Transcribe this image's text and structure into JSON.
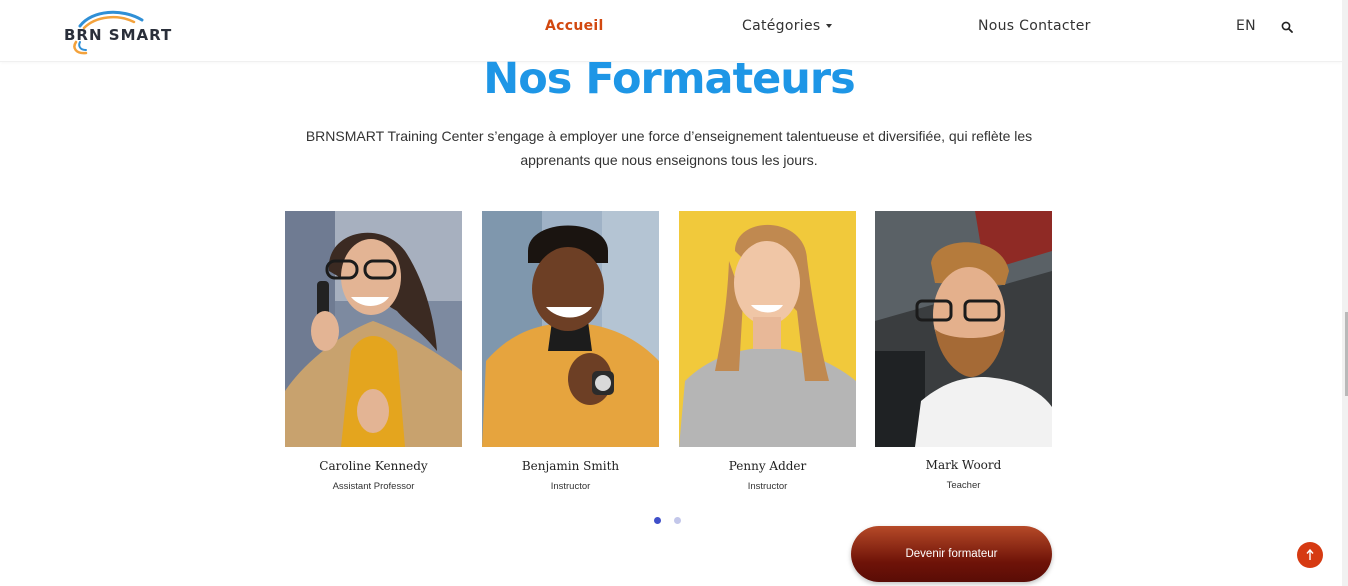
{
  "nav": {
    "logo_text": "BRN SMART",
    "home": "Accueil",
    "categories": "Catégories",
    "contact": "Nous Contacter",
    "language": "EN"
  },
  "section": {
    "title": "Nos Formateurs",
    "intro": "BRNSMART Training Center s’engage à employer une force d’enseignement talentueuse et diversifiée, qui reflète les apprenants que nous enseignons tous les jours."
  },
  "trainers": [
    {
      "name": "Caroline Kennedy",
      "role": "Assistant Professor"
    },
    {
      "name": "Benjamin Smith",
      "role": "Instructor"
    },
    {
      "name": "Penny Adder",
      "role": "Instructor"
    },
    {
      "name": "Mark Woord",
      "role": "Teacher"
    }
  ],
  "carousel": {
    "pages": 2,
    "active": 1
  },
  "cta": {
    "label": "Devenir formateur"
  },
  "colors": {
    "accent": "#d2480f",
    "title_blue": "#1e96e6",
    "cta_dark": "#6e1308",
    "dot_active": "#3f4fc9"
  }
}
